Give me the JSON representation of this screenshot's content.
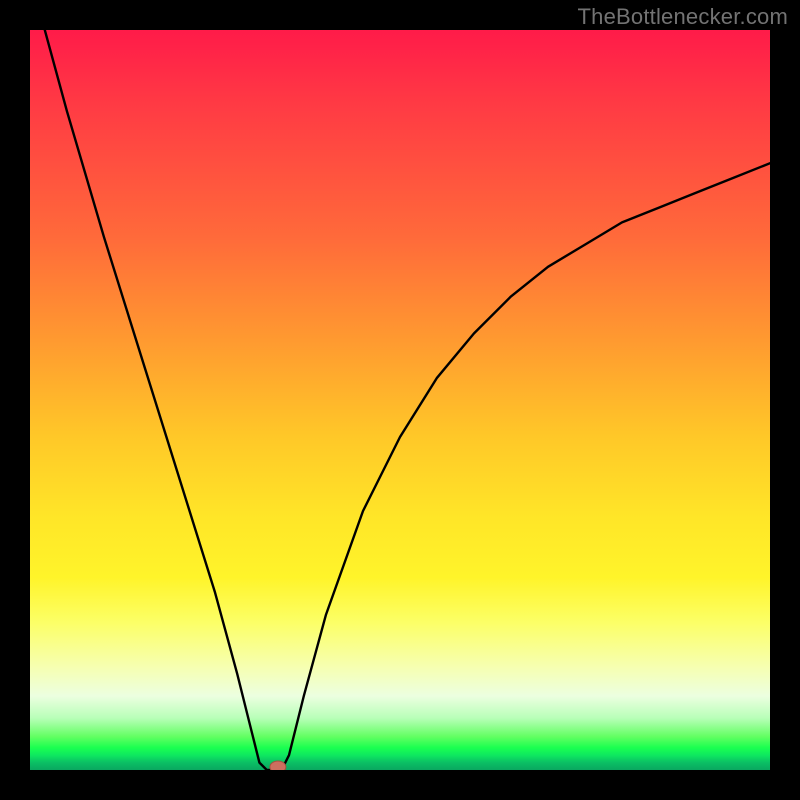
{
  "watermark": "TheBottlenecker.com",
  "chart_data": {
    "type": "line",
    "title": "",
    "xlabel": "",
    "ylabel": "",
    "xlim": [
      0,
      100
    ],
    "ylim": [
      0,
      100
    ],
    "grid": false,
    "legend": false,
    "curve_points": [
      {
        "x": 2,
        "y": 100
      },
      {
        "x": 5,
        "y": 89
      },
      {
        "x": 10,
        "y": 72
      },
      {
        "x": 15,
        "y": 56
      },
      {
        "x": 20,
        "y": 40
      },
      {
        "x": 25,
        "y": 24
      },
      {
        "x": 28,
        "y": 13
      },
      {
        "x": 30,
        "y": 5
      },
      {
        "x": 31,
        "y": 1
      },
      {
        "x": 32,
        "y": 0
      },
      {
        "x": 33,
        "y": 0
      },
      {
        "x": 34,
        "y": 0
      },
      {
        "x": 35,
        "y": 2
      },
      {
        "x": 37,
        "y": 10
      },
      {
        "x": 40,
        "y": 21
      },
      {
        "x": 45,
        "y": 35
      },
      {
        "x": 50,
        "y": 45
      },
      {
        "x": 55,
        "y": 53
      },
      {
        "x": 60,
        "y": 59
      },
      {
        "x": 65,
        "y": 64
      },
      {
        "x": 70,
        "y": 68
      },
      {
        "x": 75,
        "y": 71
      },
      {
        "x": 80,
        "y": 74
      },
      {
        "x": 85,
        "y": 76
      },
      {
        "x": 90,
        "y": 78
      },
      {
        "x": 95,
        "y": 80
      },
      {
        "x": 100,
        "y": 82
      }
    ],
    "marker": {
      "x": 33.5,
      "y": 0,
      "color": "#cc6f5f"
    },
    "colors": {
      "curve": "#000000",
      "background_top": "#ff1b49",
      "background_mid": "#ffe628",
      "background_bottom": "#0aa760",
      "frame": "#000000",
      "watermark": "#737373"
    }
  }
}
